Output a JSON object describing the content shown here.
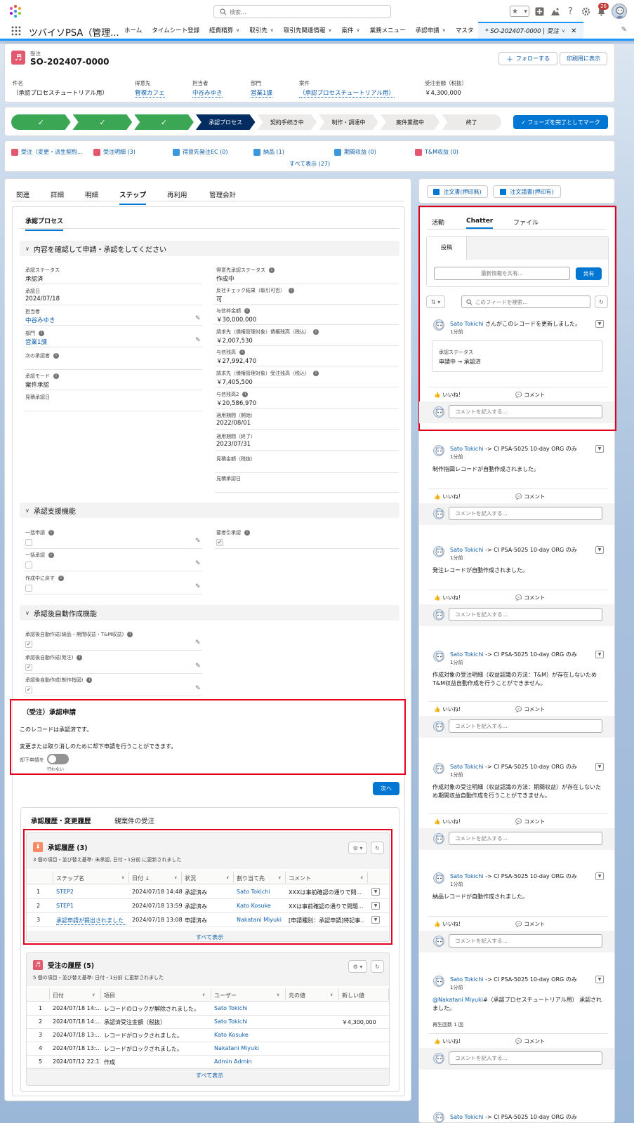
{
  "global": {
    "search_placeholder": "検索...",
    "notif_count": "26"
  },
  "nav": {
    "app_name": "ツバイソPSA（管理...",
    "items": [
      {
        "label": "ホーム",
        "has_menu": false
      },
      {
        "label": "タイムシート登録",
        "has_menu": false
      },
      {
        "label": "経費精算",
        "has_menu": true
      },
      {
        "label": "取引先",
        "has_menu": true
      },
      {
        "label": "取引先関連情報",
        "has_menu": true
      },
      {
        "label": "案件",
        "has_menu": true
      },
      {
        "label": "業務メニュー",
        "has_menu": false
      },
      {
        "label": "承認申請",
        "has_menu": true
      },
      {
        "label": "マスタ",
        "has_menu": false
      }
    ],
    "active_tab": "* SO-202407-0000 | 受注"
  },
  "record": {
    "object": "受注",
    "name": "SO-202407-0000",
    "follow": "フォローする",
    "print": "印刷用に表示",
    "fields": [
      {
        "label": "件名",
        "value": "（承認プロセスチュートリアル用）",
        "link": false
      },
      {
        "label": "得意先",
        "value": "菅裸カフェ",
        "link": true
      },
      {
        "label": "担当者",
        "value": "中谷みゆき",
        "link": true
      },
      {
        "label": "部門",
        "value": "営業1課",
        "link": true
      },
      {
        "label": "案件",
        "value": "（承認プロセスチュートリアル用）",
        "link": true
      },
      {
        "label": "受注金額（税抜）",
        "value": "￥4,300,000",
        "link": false
      }
    ]
  },
  "path": {
    "steps": [
      "✓",
      "✓",
      "✓",
      "承認プロセス",
      "契約手続き中",
      "制作・調達中",
      "案件業務中",
      "終了"
    ],
    "complete_button": "✓ フェーズを完了としてマーク"
  },
  "related": {
    "links": [
      "受注（変更・派生契約...",
      "受注明細 (3)",
      "得意先発注EC (0)",
      "納品 (1)",
      "期間収益 (0)",
      "T&M収益 (0)"
    ],
    "show_all": "すべて表示 (27)"
  },
  "tabs": [
    "関連",
    "詳細",
    "明細",
    "ステップ",
    "再利用",
    "管理会計"
  ],
  "step_tab": "承認プロセス",
  "sec1": {
    "title": "内容を確認して申請・承認をしてください",
    "left": [
      {
        "label": "承認ステータス",
        "value": "承認済",
        "link": false,
        "info": false,
        "edit": false
      },
      {
        "label": "承認日",
        "value": "2024/07/18",
        "link": false,
        "info": false,
        "edit": false
      },
      {
        "label": "担当者",
        "value": "中谷みゆき",
        "link": true,
        "info": false,
        "edit": true
      },
      {
        "label": "部門",
        "value": "営業1課",
        "link": true,
        "info": true,
        "edit": true
      },
      {
        "label": "次の承認者",
        "value": "",
        "link": false,
        "info": true,
        "edit": false
      },
      {
        "label": "承認モード",
        "value": "案件承認",
        "link": false,
        "info": true,
        "edit": false
      },
      {
        "label": "見積承認日",
        "value": "",
        "link": false,
        "info": false,
        "edit": false
      }
    ],
    "right": [
      {
        "label": "得意先承認ステータス",
        "value": "作成中",
        "info": true
      },
      {
        "label": "反社チェック結果（取引可否）",
        "value": "可",
        "info": true
      },
      {
        "label": "与信枠金額",
        "value": "￥30,000,000",
        "info": true
      },
      {
        "label": "請求先（債権管理対象）債権残高（税込）",
        "value": "￥2,007,530",
        "info": true
      },
      {
        "label": "与信残高",
        "value": "￥27,992,470",
        "info": true
      },
      {
        "label": "請求先（債権管理対象）受注残高（税込）",
        "value": "￥7,405,500",
        "info": true
      },
      {
        "label": "与信残高2",
        "value": "￥20,586,970",
        "info": true
      },
      {
        "label": "適用期間（開始）",
        "value": "2022/08/01",
        "info": false
      },
      {
        "label": "適用期間（終了）",
        "value": "2023/07/31",
        "info": false
      },
      {
        "label": "見積金額（税抜）",
        "value": "",
        "info": false
      },
      {
        "label": "見積承認日",
        "value": "",
        "info": false
      }
    ]
  },
  "sec2": {
    "title": "承認支援機能",
    "left": [
      {
        "label": "一括申請",
        "checked": false
      },
      {
        "label": "一括承認",
        "checked": false
      },
      {
        "label": "作成中に戻す",
        "checked": false
      }
    ],
    "right_label": "要者引承認",
    "right_checked": true
  },
  "sec3": {
    "title": "承認後自動作成機能",
    "items": [
      {
        "label": "承認後自動作成(納品・期間収益・T&M収益)",
        "checked": true
      },
      {
        "label": "承認後自動作成(発注)",
        "checked": true
      },
      {
        "label": "承認後自動作成(制作指図)",
        "checked": true
      }
    ]
  },
  "approval_req": {
    "title": "（受注）承認申請",
    "line1": "このレコードは承認済です。",
    "line2": "変更または取り消しのために却下申請を行うことができます。",
    "toggle_label": "却下申請を",
    "toggle_state": "行わない",
    "next": "次へ"
  },
  "history_tabs": [
    "承認履歴・変更履歴",
    "親案件の受注"
  ],
  "approval_history": {
    "title": "承認履歴 (3)",
    "meta": "3 個の項目・並び替え基準: 未承認, 日付・1分前 に更新されました",
    "columns": [
      "ステップ名",
      "日付 ↓",
      "状況",
      "割り当て先",
      "コメント"
    ],
    "rows": [
      [
        "1",
        "STEP2",
        "2024/07/18 14:48",
        "承認済み",
        "Sato Tokichi",
        "XXXは事前確認の通りで問..."
      ],
      [
        "2",
        "STEP1",
        "2024/07/18 13:59",
        "承認済み",
        "Kato Kosuke",
        "XXは事前確認の通りで問題..."
      ],
      [
        "3",
        "承認申請が提出されました",
        "2024/07/18 13:08",
        "申請済み",
        "Nakatani Miyuki",
        "[申請種別：承認申請]特記事..."
      ]
    ],
    "show_all": "すべて表示"
  },
  "order_history": {
    "title": "受注の履歴 (5)",
    "meta": "5 個の項目・並び替え基準: 日付・1分前 に更新されました",
    "columns": [
      "日付",
      "項目",
      "ユーザー",
      "元の値",
      "新しい値"
    ],
    "rows": [
      [
        "1",
        "2024/07/18 14:...",
        "レコードのロックが解除されました。",
        "Sato Tokichi",
        "",
        ""
      ],
      [
        "2",
        "2024/07/18 14:...",
        "承認済受注金額（税抜）",
        "Sato Tokichi",
        "",
        "￥4,300,000"
      ],
      [
        "3",
        "2024/07/18 13:...",
        "レコードがロックされました。",
        "Kato Kosuke",
        "",
        ""
      ],
      [
        "4",
        "2024/07/18 13:...",
        "レコードがロックされました。",
        "Nakatani Miyuki",
        "",
        ""
      ],
      [
        "5",
        "2024/07/12 22:11",
        "作成",
        "Admin Admin",
        "",
        ""
      ]
    ],
    "show_all": "すべて表示"
  },
  "side_buttons": [
    "注文書(押印無)",
    "注文請書(押印有)"
  ],
  "chatter": {
    "tabs": [
      "活動",
      "Chatter",
      "ファイル"
    ],
    "post_tab": "投稿",
    "share_placeholder": "最新情報を共有...",
    "share_button": "共有",
    "feed_search": "このフィードを検索...",
    "like": "いいね!",
    "comment": "コメント",
    "comment_placeholder": "コメントを記入する...",
    "first": {
      "author": "Sato Tokichi",
      "action": " さんがこのレコードを更新しました。",
      "time": "1分前",
      "field": "承認ステータス",
      "change": "申請中 → 承認済"
    },
    "posts": [
      {
        "author": "Sato Tokichi",
        "target": " -> CI PSA-5025 10-day ORG のみ",
        "time": "1分前",
        "body": "制作指図レコードが自動作成されました。"
      },
      {
        "author": "Sato Tokichi",
        "target": " -> CI PSA-5025 10-day ORG のみ",
        "time": "1分前",
        "body": "発注レコードが自動作成されました。"
      },
      {
        "author": "Sato Tokichi",
        "target": " -> CI PSA-5025 10-day ORG のみ",
        "time": "1分前",
        "body": "作成対象の受注明細（収益認識の方法：T&M）が存在しないためT&M収益自動作成を行うことができません。"
      },
      {
        "author": "Sato Tokichi",
        "target": " -> CI PSA-5025 10-day ORG のみ",
        "time": "1分前",
        "body": "作成対象の受注明細（収益認識の方法：期間収益）が存在しないため期間収益自動作成を行うことができません。"
      },
      {
        "author": "Sato Tokichi",
        "target": " -> CI PSA-5025 10-day ORG のみ",
        "time": "1分前",
        "body": "納品レコードが自動作成されました。"
      },
      {
        "author": "Sato Tokichi",
        "target": " -> CI PSA-5025 10-day ORG のみ",
        "time": "1分前",
        "body_mention": "@Nakatani Miyuki",
        "body": "#（承認プロセスチュートリアル用） 承認されました。",
        "extra": "再生回数 1 回"
      }
    ],
    "last_author": "Sato Tokichi",
    "last_target": " -> CI PSA-5025 10-day ORG のみ"
  }
}
